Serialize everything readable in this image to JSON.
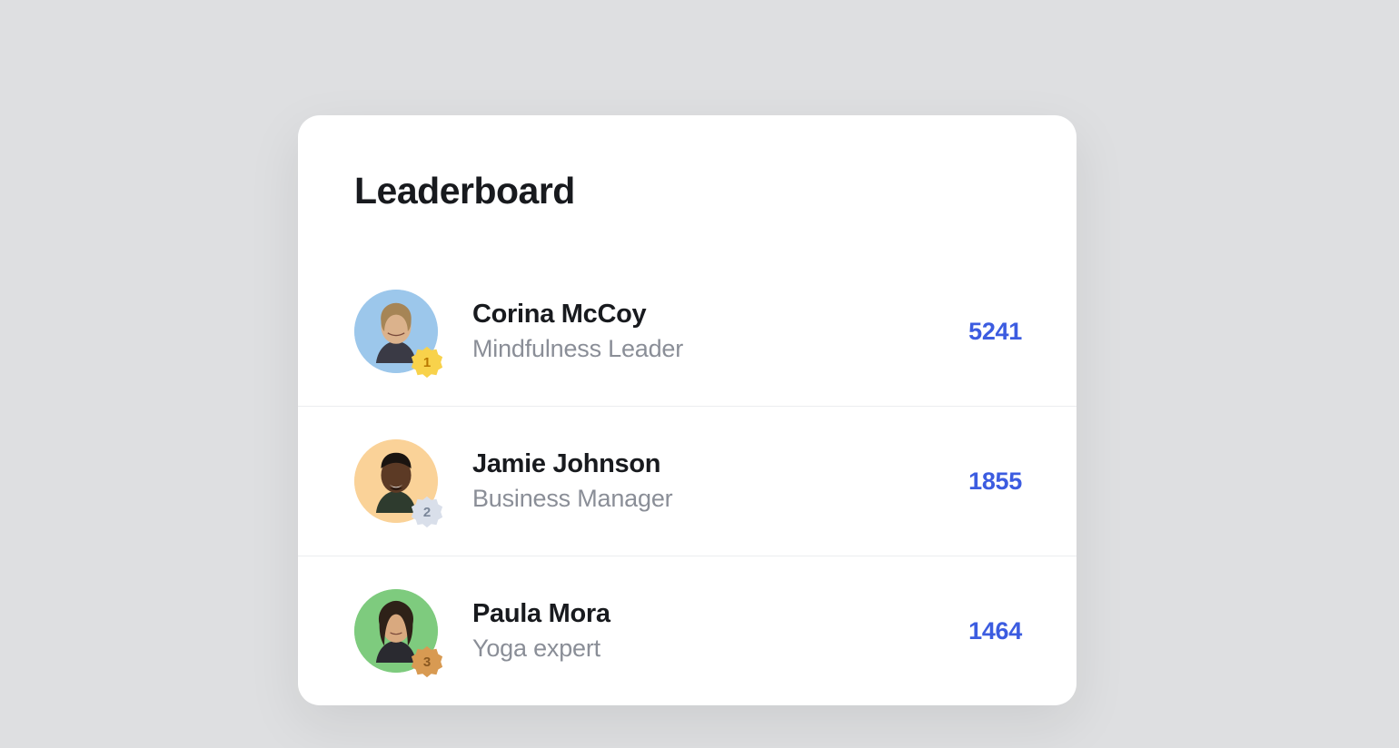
{
  "title": "Leaderboard",
  "entries": [
    {
      "rank": "1",
      "name": "Corina McCoy",
      "role": "Mindfulness Leader",
      "score": "5241"
    },
    {
      "rank": "2",
      "name": "Jamie Johnson",
      "role": "Business Manager",
      "score": "1855"
    },
    {
      "rank": "3",
      "name": "Paula Mora",
      "role": "Yoga expert",
      "score": "1464"
    }
  ]
}
